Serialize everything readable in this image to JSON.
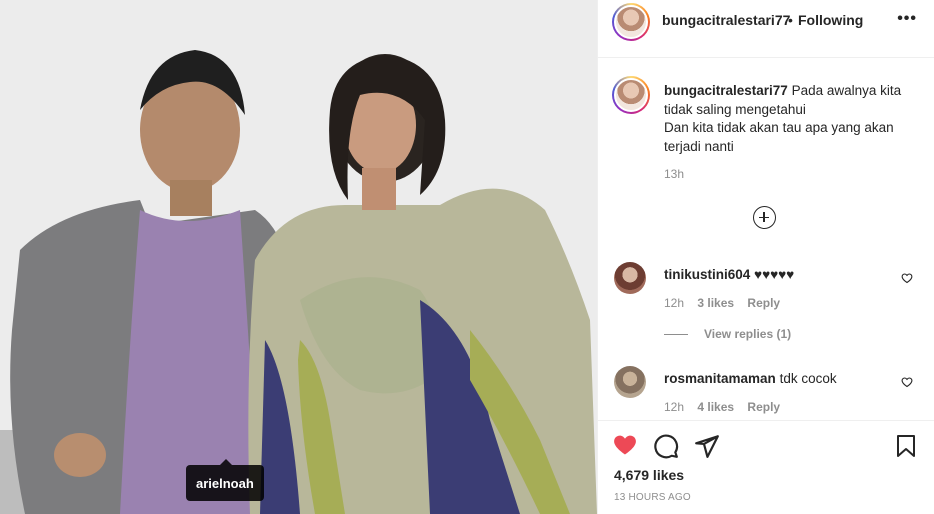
{
  "post": {
    "username": "bungacitralestari77",
    "separator": "•",
    "follow_status": "Following",
    "more_icon": "more-horizontal-icon",
    "tag_label": "arielnoah"
  },
  "caption": {
    "username": "bungacitralestari77",
    "lines": [
      "Pada awalnya kita",
      "tidak saling mengetahui",
      "Dan kita tidak akan tau apa yang akan",
      "terjadi nanti"
    ],
    "time": "13h"
  },
  "load_more_icon": "plus-circle-icon",
  "comments": [
    {
      "username": "tinikustini604",
      "text": "♥♥♥♥♥",
      "time": "12h",
      "likes": "3 likes",
      "reply_label": "Reply"
    },
    {
      "username": "rosmanitamaman",
      "text": "tdk cocok",
      "time": "12h",
      "likes": "4 likes",
      "reply_label": "Reply"
    }
  ],
  "view_replies": "View replies (1)",
  "actions": {
    "like_icon": "heart-filled-icon",
    "comment_icon": "comment-icon",
    "share_icon": "share-icon",
    "save_icon": "bookmark-icon",
    "like_color": "#ed4956"
  },
  "likes_count": "4,679 likes",
  "timestamp": "13 HOURS AGO"
}
